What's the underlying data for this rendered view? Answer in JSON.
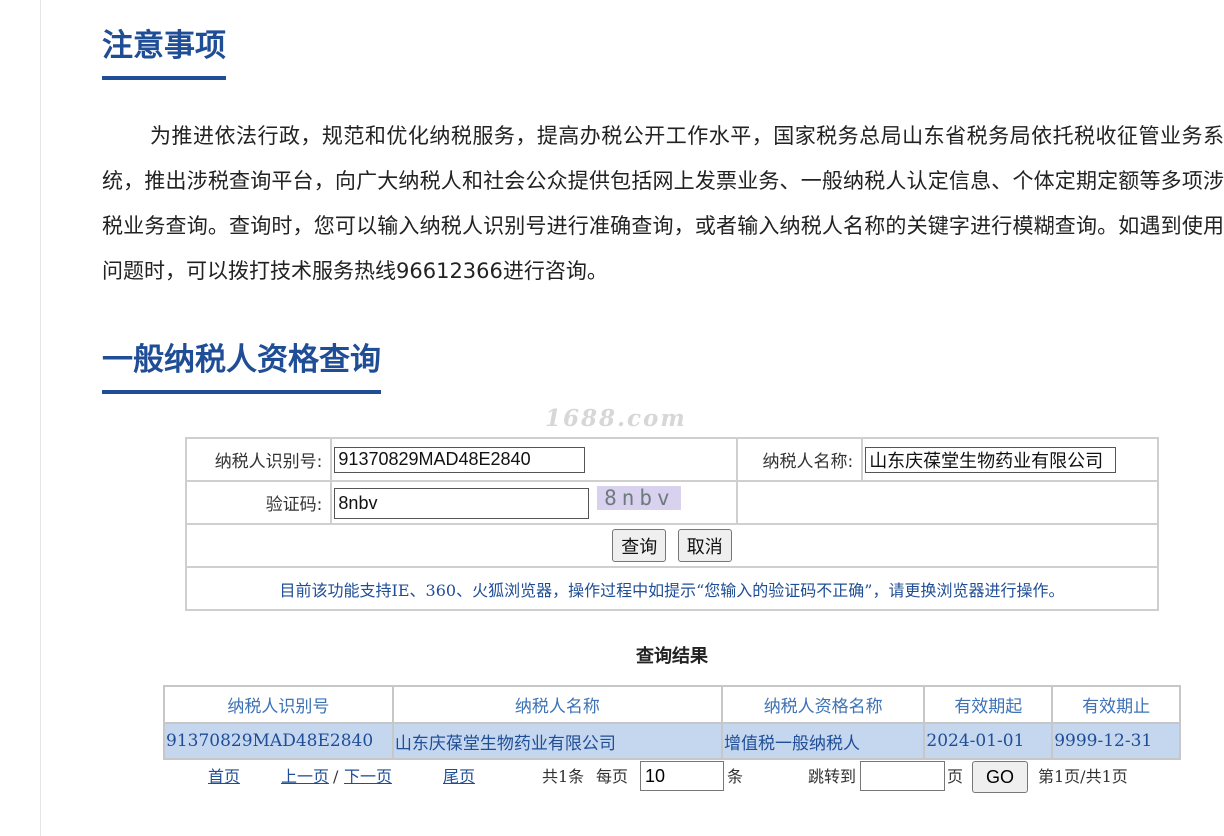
{
  "sections": {
    "notice_title": "注意事项",
    "notice_text": "为推进依法行政，规范和优化纳税服务，提高办税公开工作水平，国家税务总局山东省税务局依托税收征管业务系统，推出涉税查询平台，向广大纳税人和社会公众提供包括网上发票业务、一般纳税人认定信息、个体定期定额等多项涉税业务查询。查询时，您可以输入纳税人识别号进行准确查询，或者输入纳税人名称的关键字进行模糊查询。如遇到使用问题时，可以拨打技术服务热线96612366进行咨询。",
    "query_title": "一般纳税人资格查询"
  },
  "watermark": "1688.com",
  "form": {
    "tax_id_label": "纳税人识别号:",
    "tax_id_value": "91370829MAD48E2840",
    "tax_name_label": "纳税人名称:",
    "tax_name_value": "山东庆葆堂生物药业有限公司",
    "captcha_label": "验证码:",
    "captcha_value": "8nbv",
    "captcha_image_text": "8nbv",
    "query_button": "查询",
    "cancel_button": "取消",
    "browser_notice": "目前该功能支持IE、360、火狐浏览器，操作过程中如提示“您输入的验证码不正确”，请更换浏览器进行操作。"
  },
  "results": {
    "title": "查询结果",
    "columns": [
      "纳税人识别号",
      "纳税人名称",
      "纳税人资格名称",
      "有效期起",
      "有效期止"
    ],
    "rows": [
      [
        "91370829MAD48E2840",
        "山东庆葆堂生物药业有限公司",
        "增值税一般纳税人",
        "2024-01-01",
        "9999-12-31"
      ]
    ]
  },
  "pager": {
    "first": "首页",
    "prev": "上一页",
    "separator": "/",
    "next": "下一页",
    "last": "尾页",
    "total": "共1条",
    "per_page_label": "每页",
    "per_page_value": "10",
    "per_page_unit": "条",
    "jump_label": "跳转到",
    "jump_value": "",
    "page_unit": "页",
    "go": "GO",
    "status": "第1页/共1页"
  },
  "colors": {
    "accent": "#1f4e96",
    "row_highlight": "#c5d6ef",
    "header_text": "#3d72b6"
  }
}
